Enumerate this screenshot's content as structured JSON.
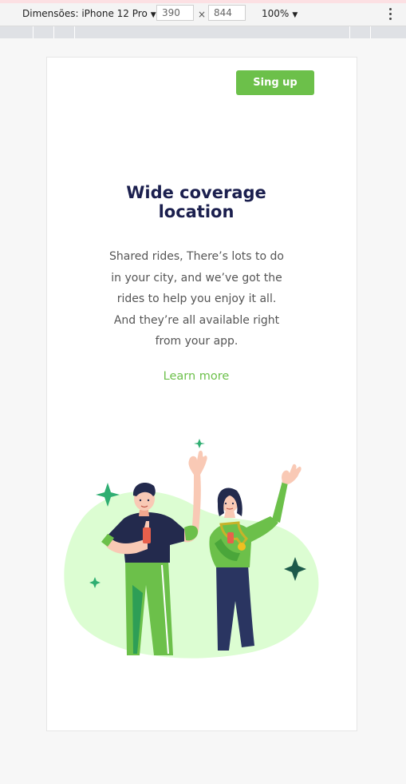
{
  "devtools": {
    "device_label": "Dimensões: iPhone 12 Pro",
    "width_value": "390",
    "height_value": "844",
    "times_sign": "×",
    "zoom_label": "100%"
  },
  "page": {
    "signup_label": "Sing up",
    "title_line1": "Wide coverage",
    "title_line2": "location",
    "description_lines": [
      "Shared rides, There’s lots to do",
      "in your city, and we’ve got the",
      "rides to help you enjoy it all.",
      "And they’re all available right",
      "from your app."
    ],
    "learn_more_label": "Learn more"
  },
  "colors": {
    "accent_green": "#6cc04a",
    "title_navy": "#1b1f4e",
    "blob_green": "#dcfdd2"
  },
  "icons": [
    "chevron-down-icon",
    "more-vertical-icon",
    "sparkle-icon"
  ]
}
